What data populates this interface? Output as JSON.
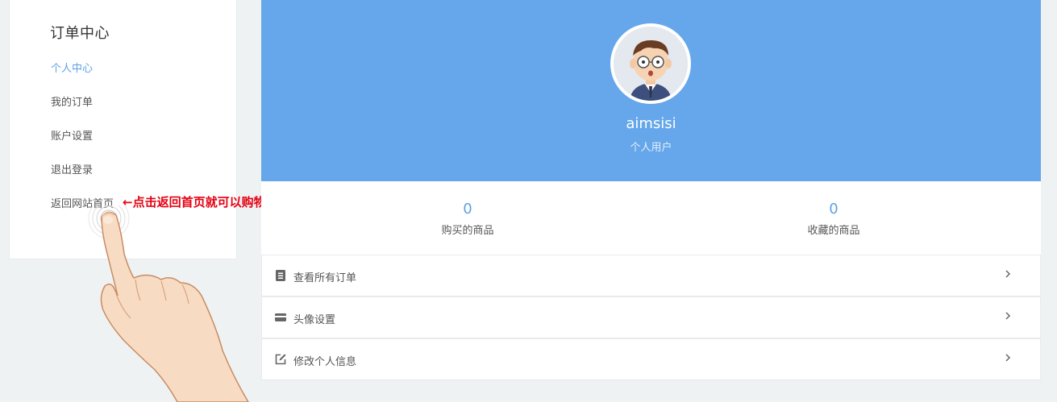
{
  "sidebar": {
    "title": "订单中心",
    "items": [
      {
        "label": "个人中心",
        "active": true
      },
      {
        "label": "我的订单",
        "active": false
      },
      {
        "label": "账户设置",
        "active": false
      },
      {
        "label": "退出登录",
        "active": false
      },
      {
        "label": "返回网站首页",
        "active": false
      }
    ]
  },
  "annotation": {
    "text": "←点击返回首页就可以购物了",
    "color": "#e60012"
  },
  "profile": {
    "username": "aimsisi",
    "user_type": "个人用户",
    "header_color": "#65a7ea"
  },
  "stats": [
    {
      "value": "0",
      "label": "购买的商品"
    },
    {
      "value": "0",
      "label": "收藏的商品"
    }
  ],
  "menu": [
    {
      "icon": "document-icon",
      "label": "查看所有订单"
    },
    {
      "icon": "credit-card-icon",
      "label": "头像设置"
    },
    {
      "icon": "edit-icon",
      "label": "修改个人信息"
    }
  ],
  "colors": {
    "accent": "#5fa1e6",
    "background": "#eff2f3"
  }
}
